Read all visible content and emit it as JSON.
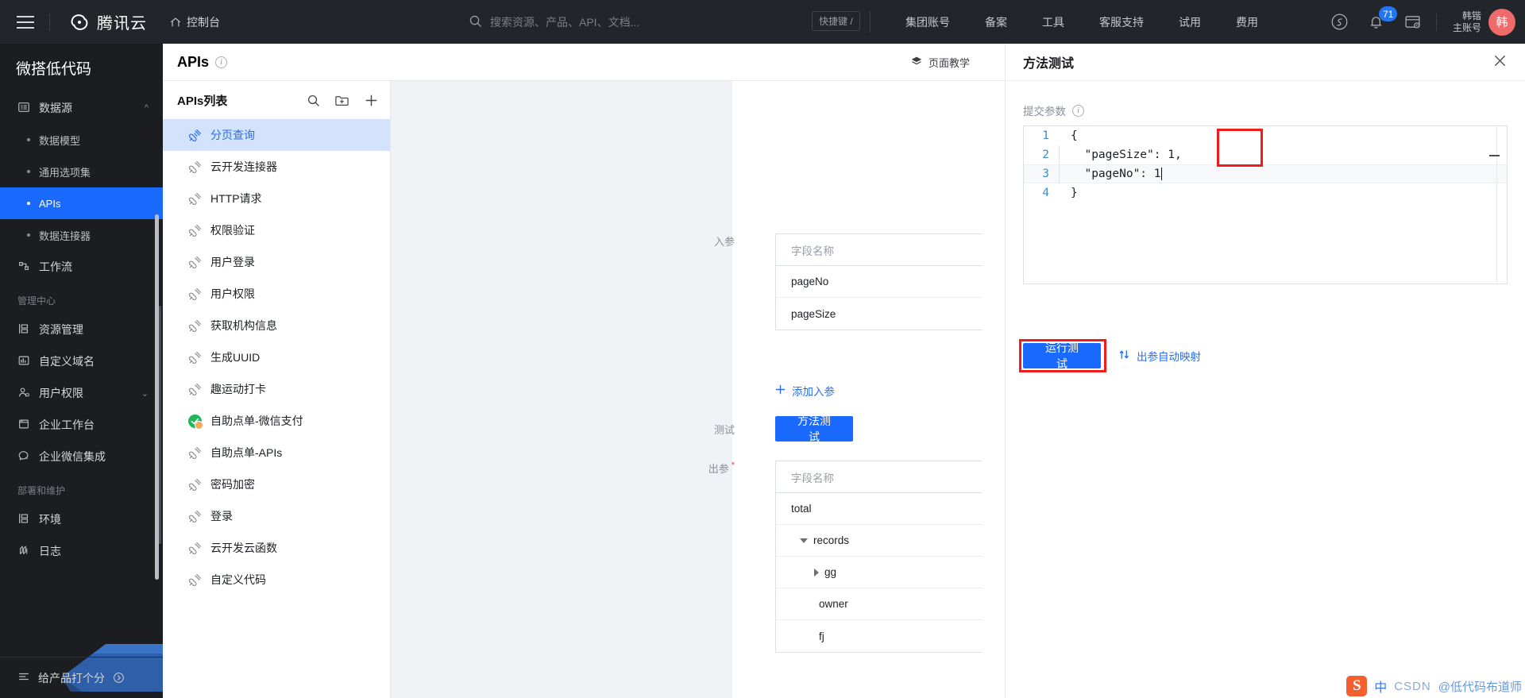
{
  "header": {
    "logo_text": "腾讯云",
    "console_label": "控制台",
    "search_placeholder": "搜索资源、产品、API、文档...",
    "shortcut_label": "快捷键 /",
    "nav": [
      {
        "label": "集团账号"
      },
      {
        "label": "备案"
      },
      {
        "label": "工具"
      },
      {
        "label": "客服支持"
      },
      {
        "label": "试用"
      },
      {
        "label": "费用"
      }
    ],
    "notification_count": "71",
    "user_name": "韩锴",
    "user_type": "主账号",
    "avatar_text": "韩"
  },
  "sidebar": {
    "title": "微搭低代码",
    "items": [
      {
        "label": "数据源",
        "type": "parent",
        "icon": "datasource-icon",
        "expanded": true
      },
      {
        "label": "数据模型",
        "type": "sub"
      },
      {
        "label": "通用选项集",
        "type": "sub"
      },
      {
        "label": "APIs",
        "type": "sub",
        "active": true
      },
      {
        "label": "数据连接器",
        "type": "sub"
      },
      {
        "label": "工作流",
        "type": "parent",
        "icon": "workflow-icon"
      }
    ],
    "group_admin": "管理中心",
    "admin_items": [
      {
        "label": "资源管理",
        "icon": "resource-icon"
      },
      {
        "label": "自定义域名",
        "icon": "domain-icon"
      },
      {
        "label": "用户权限",
        "icon": "user-permission-icon",
        "expandable": true
      },
      {
        "label": "企业工作台",
        "icon": "workbench-icon"
      },
      {
        "label": "企业微信集成",
        "icon": "wecom-icon"
      }
    ],
    "group_deploy": "部署和维护",
    "deploy_items": [
      {
        "label": "环境",
        "icon": "environment-icon"
      },
      {
        "label": "日志",
        "icon": "log-icon"
      }
    ],
    "footer_label": "给产品打个分"
  },
  "apis_page": {
    "title": "APIs",
    "tutorial_label": "页面教学",
    "list_title": "APIs列表",
    "list_items": [
      {
        "label": "分页查询",
        "icon": "plug-icon",
        "active": true
      },
      {
        "label": "云开发连接器",
        "icon": "plug-icon"
      },
      {
        "label": "HTTP请求",
        "icon": "plug-icon"
      },
      {
        "label": "权限验证",
        "icon": "plug-icon"
      },
      {
        "label": "用户登录",
        "icon": "plug-icon"
      },
      {
        "label": "用户权限",
        "icon": "plug-icon"
      },
      {
        "label": "获取机构信息",
        "icon": "plug-icon"
      },
      {
        "label": "生成UUID",
        "icon": "plug-icon"
      },
      {
        "label": "趣运动打卡",
        "icon": "plug-icon"
      },
      {
        "label": "自助点单-微信支付",
        "icon": "wechat-pay-icon"
      },
      {
        "label": "自助点单-APIs",
        "icon": "plug-icon"
      },
      {
        "label": "密码加密",
        "icon": "plug-icon"
      },
      {
        "label": "登录",
        "icon": "plug-icon"
      },
      {
        "label": "云开发云函数",
        "icon": "plug-icon"
      },
      {
        "label": "自定义代码",
        "icon": "plug-icon"
      }
    ]
  },
  "detail": {
    "input_params_label": "入参",
    "input_table_header": "字段名称",
    "input_rows": [
      "pageNo",
      "pageSize"
    ],
    "add_input_label": "添加入参",
    "test_label": "测试",
    "test_button": "方法测试",
    "output_params_label": "出参",
    "output_table_header": "字段名称",
    "output_rows": [
      {
        "name": "total",
        "indent": 0,
        "toggle": "none"
      },
      {
        "name": "records",
        "indent": 1,
        "toggle": "expanded"
      },
      {
        "name": "gg",
        "indent": 2,
        "toggle": "collapsed"
      },
      {
        "name": "owner",
        "indent": 2,
        "toggle": "none"
      },
      {
        "name": "fj",
        "indent": 2,
        "toggle": "none"
      }
    ]
  },
  "drawer": {
    "title": "方法测试",
    "submit_params_label": "提交参数",
    "code_lines": [
      {
        "no": "1",
        "text": "{"
      },
      {
        "no": "2",
        "text": "  \"pageSize\": 1,"
      },
      {
        "no": "3",
        "text": "  \"pageNo\": 1"
      },
      {
        "no": "4",
        "text": "}"
      }
    ],
    "run_button": "运行测试",
    "auto_map_label": "出参自动映射"
  },
  "watermark": {
    "ime_label": "中",
    "site": "CSDN",
    "author": "@低代码布道师"
  },
  "colors": {
    "accent": "#1a6aff",
    "link": "#2a6cf0",
    "topbar_bg": "#22252a",
    "sidebar_bg": "#1b1d21",
    "annotation": "#ee1c1c"
  }
}
